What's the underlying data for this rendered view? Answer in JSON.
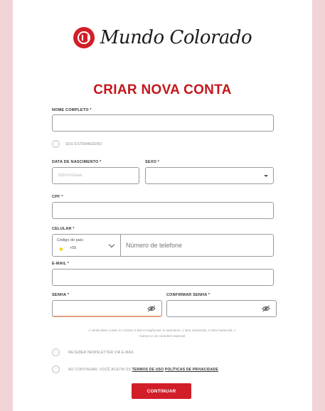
{
  "brand": {
    "name": "Mundo Colorado"
  },
  "form": {
    "title": "CRIAR NOVA CONTA",
    "full_name": {
      "label": "NOME COMPLETO *",
      "value": ""
    },
    "foreigner": {
      "label": "SOU ESTRANGEIRO",
      "checked": false
    },
    "birth_date": {
      "label": "DATA DE NASCIMENTO *",
      "placeholder": "dd/mm/aaaa"
    },
    "sex": {
      "label": "SEXO *",
      "value": ""
    },
    "cpf": {
      "label": "CPF *",
      "value": ""
    },
    "mobile": {
      "label": "CELULAR *",
      "country_label": "Código do país",
      "country_code": "+55",
      "country_flag": "brazil-flag-icon",
      "phone_placeholder": "Número de telefone"
    },
    "email": {
      "label": "E-MAIL *",
      "value": ""
    },
    "password": {
      "label": "SENHA *",
      "value": ""
    },
    "confirm_password": {
      "label": "CONFIRMAR SENHA *",
      "value": ""
    },
    "password_hint_line1": "A senha deve conter no mínimo 3 das 5 exigências: 6 caracteres, 1 letra minúscula, 1 letra maiúscula, 1",
    "password_hint_line2": "número e um caractere especial",
    "newsletter": {
      "label": "RECEBER NEWSLETTER VIA E-MAIL",
      "checked": false
    },
    "terms": {
      "prefix": "AO CONTINUAR, VOCÊ ACEITA OS",
      "terms_link": "TERMOS DE USO",
      "privacy_link": "POLÍTICAS DE PRIVACIDADE",
      "checked": false
    },
    "submit_label": "CONTINUAR"
  },
  "colors": {
    "brand_red": "#d21e28",
    "title_red": "#c4161c",
    "background": "#f0d4d6"
  }
}
